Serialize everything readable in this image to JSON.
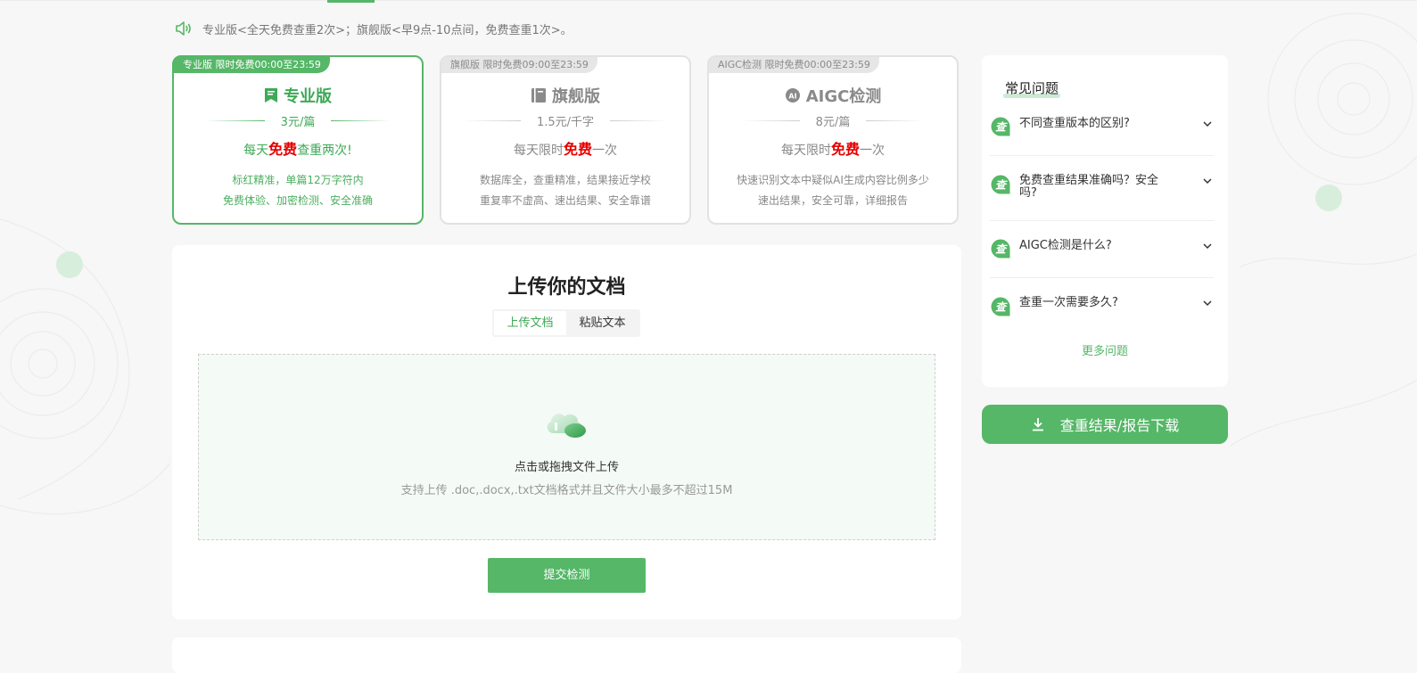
{
  "notice": {
    "text": "专业版<全天免费查重2次>；旗舰版<早9点-10点间，免费查重1次>。",
    "icon": "speaker-icon"
  },
  "cards": [
    {
      "tag": "专业版 限时免费00:00至23:59",
      "title": "专业版",
      "icon": "bookmark-icon",
      "price": "3元/篇",
      "offer_prefix": "每天",
      "offer_free": "免费",
      "offer_suffix": "查重两次!",
      "desc1": "标红精准，单篇12万字符内",
      "desc2": "免费体验、加密检测、安全准确",
      "selected": true
    },
    {
      "tag": "旗舰版 限时免费09:00至23:59",
      "title": "旗舰版",
      "icon": "book-icon",
      "price": "1.5元/千字",
      "offer_prefix": "每天限时",
      "offer_free": "免费",
      "offer_suffix": "一次",
      "desc1": "数据库全，查重精准，结果接近学校",
      "desc2": "重复率不虚高、速出结果、安全靠谱",
      "selected": false
    },
    {
      "tag": "AIGC检测 限时免费00:00至23:59",
      "title": "AIGC检测",
      "icon": "ai-icon",
      "price": "8元/篇",
      "offer_prefix": "每天限时",
      "offer_free": "免费",
      "offer_suffix": "一次",
      "desc1": "快速识别文本中疑似AI生成内容比例多少",
      "desc2": "速出结果，安全可靠，详细报告",
      "selected": false
    }
  ],
  "upload": {
    "title": "上传你的文档",
    "tabs": [
      {
        "label": "上传文档",
        "active": true
      },
      {
        "label": "粘贴文本",
        "active": false
      }
    ],
    "dropzone_main": "点击或拖拽文件上传",
    "dropzone_sub": "支持上传 .doc,.docx,.txt文档格式并且文件大小最多不超过15M",
    "submit": "提交检测"
  },
  "faq": {
    "title": "常见问题",
    "items": [
      {
        "q": "不同查重版本的区别?"
      },
      {
        "q": "免费查重结果准确吗？安全吗?"
      },
      {
        "q": "AIGC检测是什么?"
      },
      {
        "q": "查重一次需要多久?"
      }
    ],
    "more": "更多问题"
  },
  "download": {
    "label": "查重结果/报告下载",
    "icon": "download-icon"
  },
  "colors": {
    "accent": "#55b767",
    "accent_dark": "#3ea957",
    "free_red": "#e60000"
  }
}
